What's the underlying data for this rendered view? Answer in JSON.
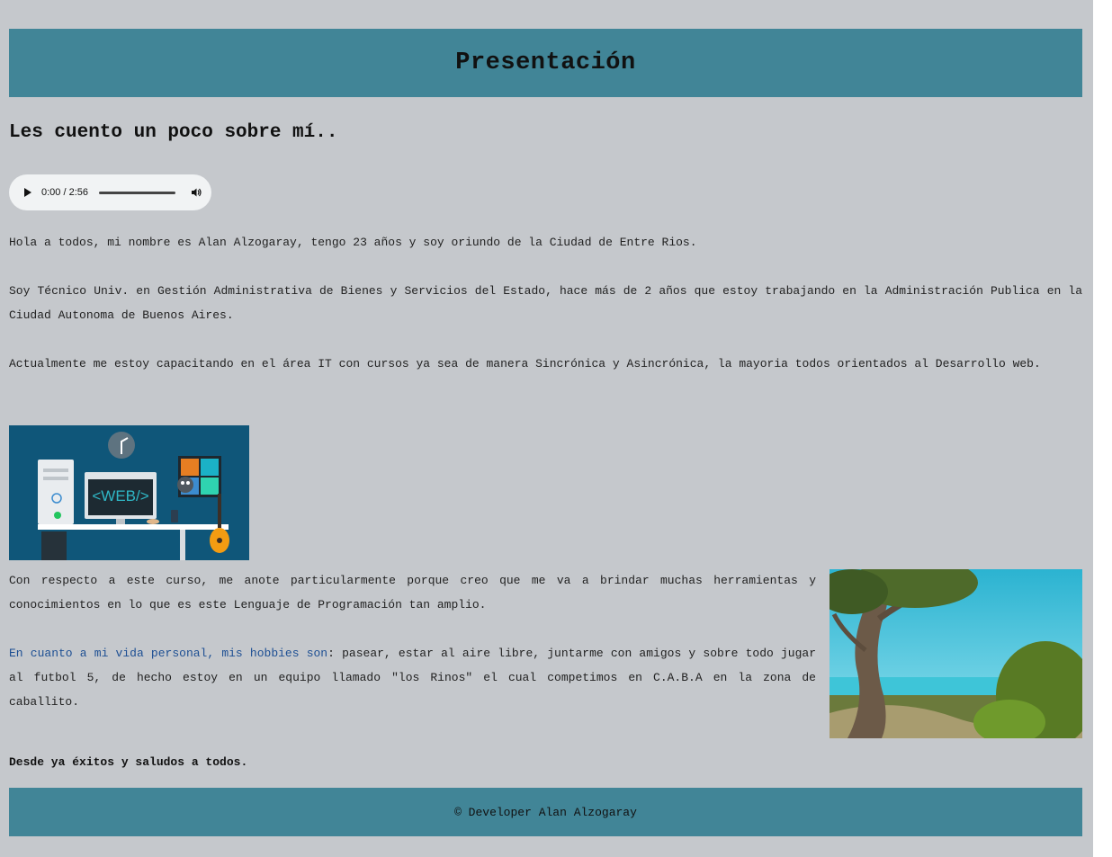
{
  "header": {
    "title": "Presentación"
  },
  "intro": {
    "heading": "Les cuento un poco sobre mí.."
  },
  "audio": {
    "time": "0:00 / 2:56",
    "progress": 0
  },
  "paragraphs": {
    "p1": "Hola a todos, mi nombre es Alan Alzogaray, tengo 23 años y soy oriundo de la Ciudad de Entre Rios.",
    "p2": "Soy Técnico Univ. en Gestión Administrativa de Bienes y Servicios del Estado, hace más de 2 años que estoy trabajando en la Administración Publica en la Ciudad Autonoma de Buenos Aires.",
    "p3": "Actualmente me estoy capacitando en el área IT con cursos ya sea de manera Sincrónica y Asincrónica, la mayoria todos orientados al Desarrollo web.",
    "p4": "Con respecto a este curso, me anote particularmente porque creo que me va a brindar muchas herramientas y conocimientos en lo que es este Lenguaje de Programación tan amplio.",
    "p5_highlight": "En cuanto a mi vida personal, mis hobbies son",
    "p5_rest": ": pasear, estar al aire libre, juntarme con amigos y sobre todo jugar al futbol 5, de hecho estoy en un equipo llamado \"los Rinos\" el cual competimos en C.A.B.A en la zona de caballito.",
    "closing": "Desde ya éxitos y saludos a todos."
  },
  "images": {
    "web_label": "<WEB/>"
  },
  "footer": {
    "text": "© Developer Alan Alzogaray"
  },
  "colors": {
    "background": "#c5c8cc",
    "banner": "#418597",
    "highlight": "#1d4f93"
  }
}
